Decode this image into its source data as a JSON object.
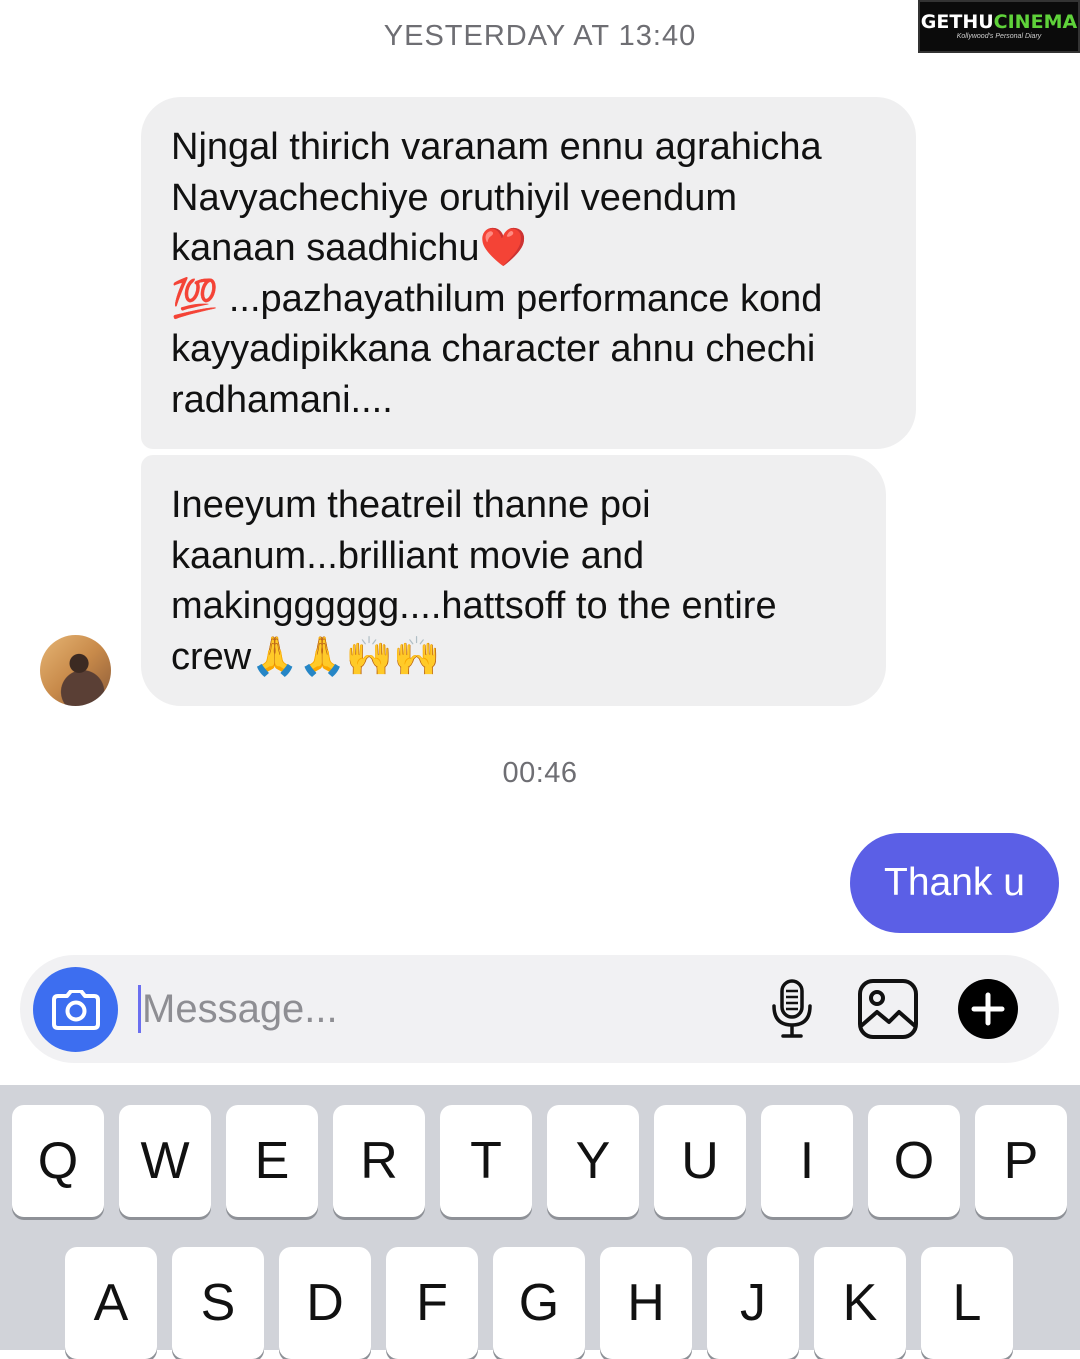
{
  "watermark": {
    "brand_a": "GETHU",
    "brand_b": "CINEMA",
    "tagline": "Kollywood's Personal Diary"
  },
  "thread": {
    "timestamp_1": "YESTERDAY AT 13:40",
    "timestamp_2": "00:46",
    "received": [
      {
        "lines": [
          "Njngal thirich varanam ennu agrahicha",
          "Navyachechiye oruthiyil veendum",
          "kanaan saadhichu❤️",
          "💯 ...pazhayathilum performance kond",
          "kayyadipikkana character ahnu chechi",
          "radhamani...."
        ]
      },
      {
        "lines": [
          "Ineeyum theatreil thanne poi",
          "kaanum...brilliant movie and",
          "makingggggg....hattsoff to the entire",
          "crew🙏🙏🙌🙌"
        ]
      }
    ],
    "sent": [
      {
        "text": "Thank u"
      }
    ]
  },
  "composer": {
    "placeholder": "Message...",
    "icons": [
      "camera-icon",
      "microphone-icon",
      "photo-icon",
      "plus-icon"
    ],
    "camera_color": "#3d6ef0",
    "sent_bubble_color": "#5b5fe6"
  },
  "keyboard": {
    "row1": [
      "Q",
      "W",
      "E",
      "R",
      "T",
      "Y",
      "U",
      "I",
      "O",
      "P"
    ],
    "row2": [
      "A",
      "S",
      "D",
      "F",
      "G",
      "H",
      "J",
      "K",
      "L"
    ]
  }
}
